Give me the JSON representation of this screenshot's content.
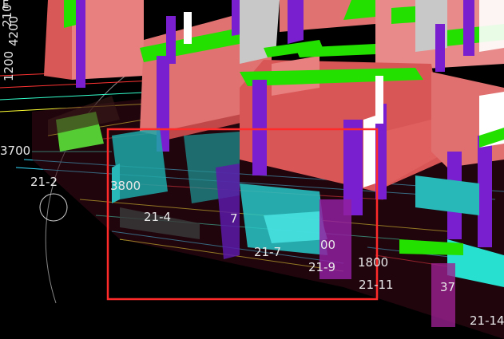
{
  "viewport": {
    "background_color": "#000000",
    "selection_color": "#ff2a2a"
  },
  "colors": {
    "column": "#7a1fd0",
    "beam_top": "#23e000",
    "wall": "#e05a5a",
    "slab": "#f08a8a",
    "glass": "#28b8b8",
    "gray_panel": "#c8c8c8",
    "grid_line": "#d8d8d8"
  },
  "dimension_labels": {
    "left_top_vertical": "210",
    "left_mid_vertical": "4200",
    "left_low_vertical": "1200",
    "left_edge": "3700",
    "center_3800": "3800",
    "right_1800": "1800",
    "partial_00": "00",
    "partial_7": "7",
    "bottom_right_37": "37"
  },
  "grid_labels": {
    "axis_21_2": "21-2",
    "axis_21_4": "21-4",
    "axis_21_7": "21-7",
    "axis_21_9": "21-9",
    "axis_21_11": "21-11",
    "axis_21_14": "21-14"
  },
  "misc": {
    "top_left_glyph": "E"
  }
}
